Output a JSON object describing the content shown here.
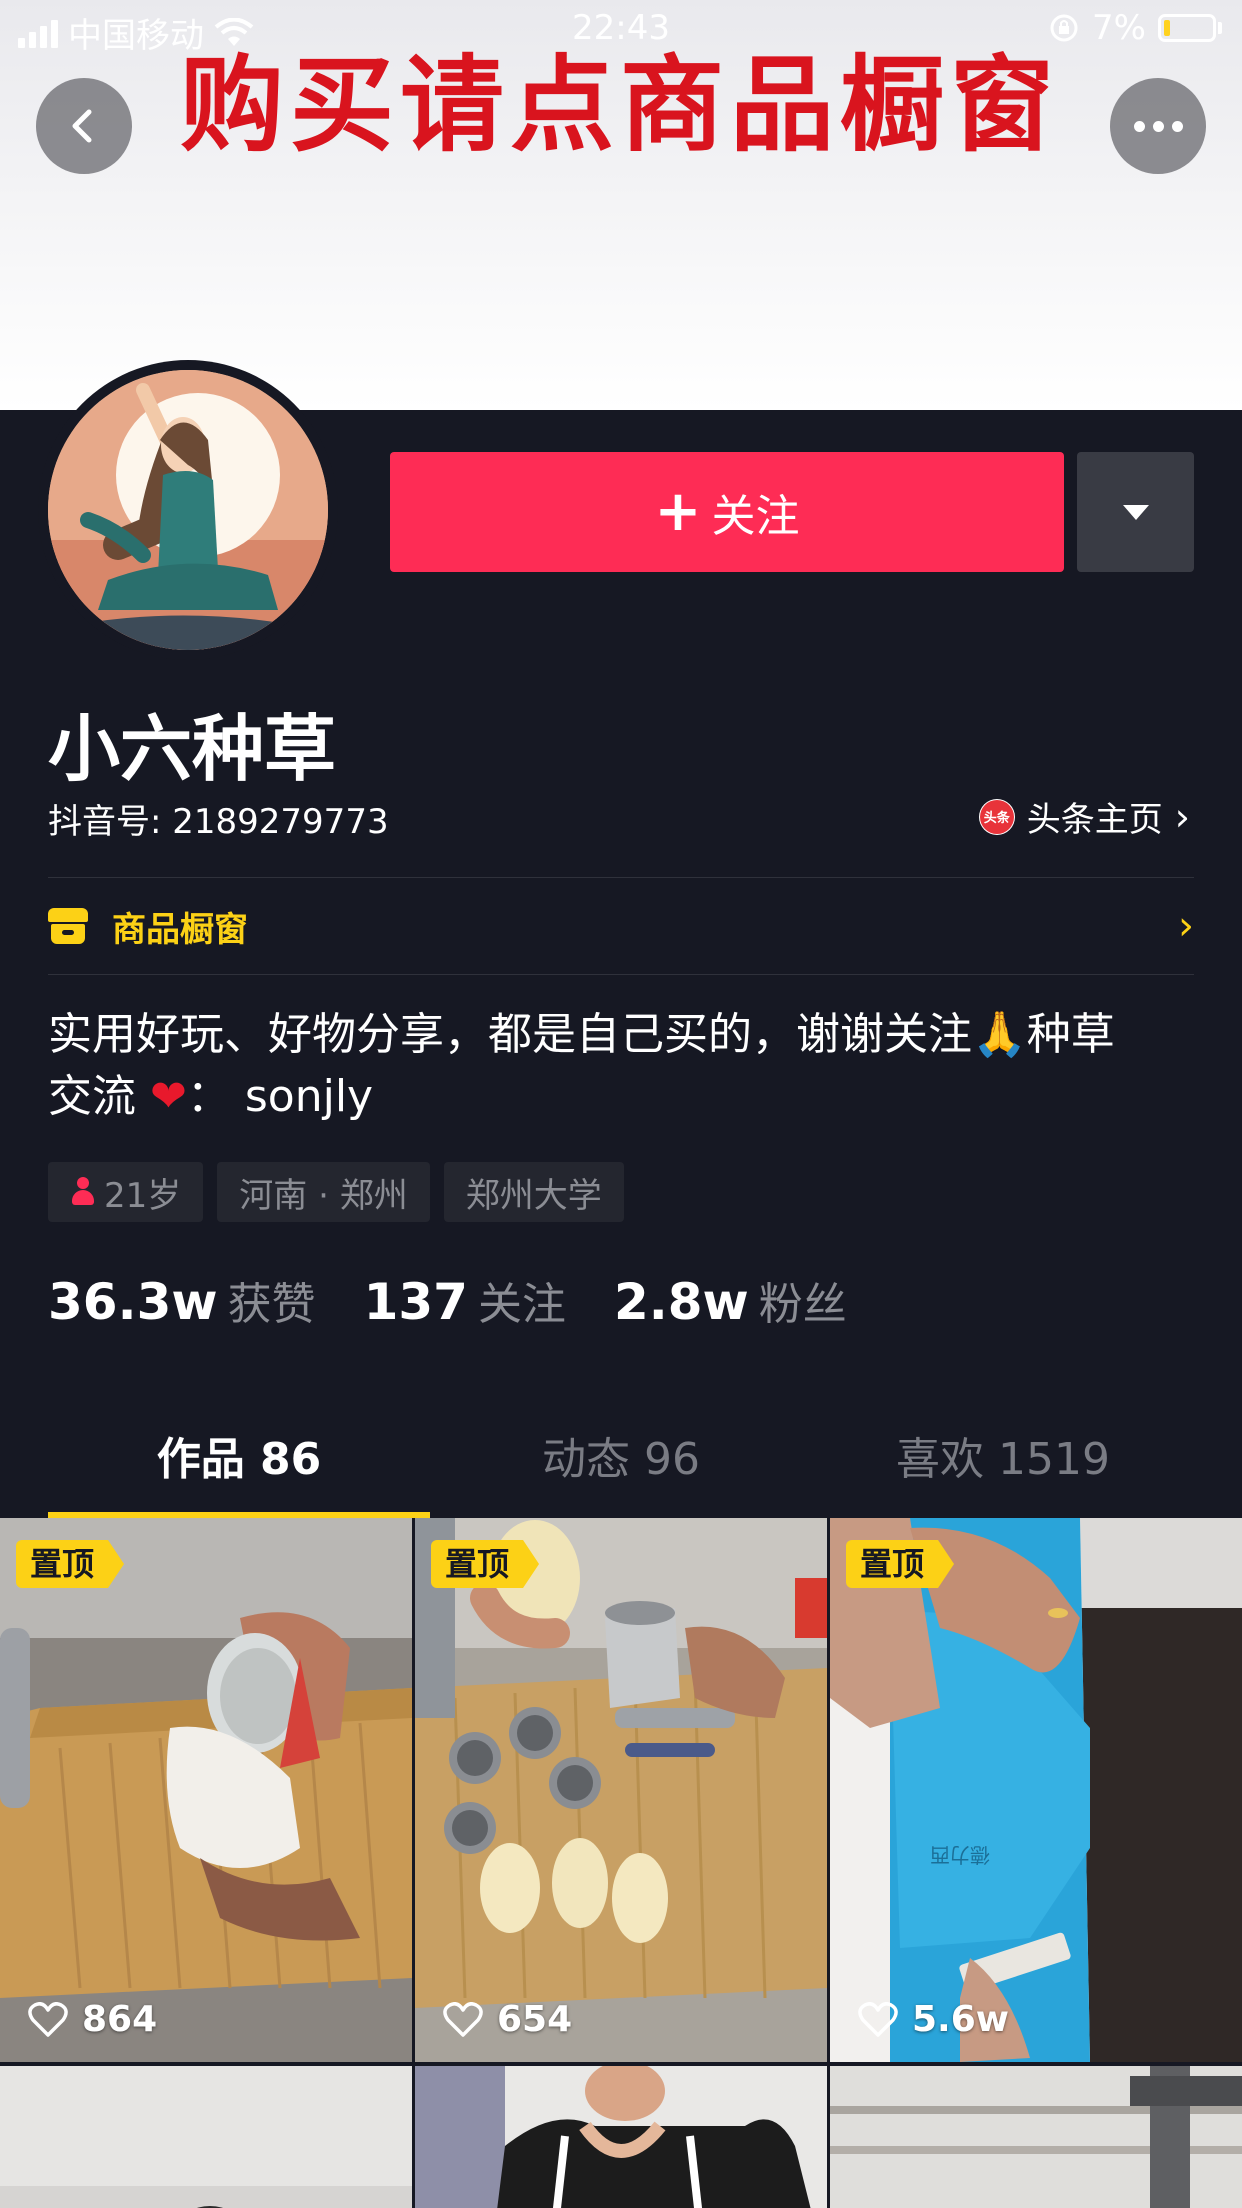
{
  "status_bar": {
    "carrier": "中国移动",
    "time": "22:43",
    "battery": "7%"
  },
  "banner": {
    "text": "购买请点商品橱窗"
  },
  "header": {
    "back_icon": "chevron-left-icon",
    "more_icon": "more-dots-icon"
  },
  "profile": {
    "nickname": "小六种草",
    "douyin_id": "抖音号: 2189279773",
    "toutiao_link": "头条主页",
    "toutiao_icon_text": "头条",
    "follow_label": "关注",
    "shop_window": "商品橱窗",
    "bio_line1_a": "实用好玩、好物分享，都是自己买的，谢谢关注",
    "bio_line1_b": "种草",
    "bio_line2_a": "交流",
    "bio_line2_b": "：  sonjly",
    "tags": {
      "age": "21岁",
      "location": "河南 · 郑州",
      "school": "郑州大学"
    },
    "stats": {
      "likes_num": "36.3w",
      "likes_label": "获赞",
      "following_num": "137",
      "following_label": "关注",
      "fans_num": "2.8w",
      "fans_label": "粉丝"
    }
  },
  "tabs": {
    "works": "作品 86",
    "moments": "动态 96",
    "liked": "喜欢 1519"
  },
  "grid": {
    "pin_label": "置顶",
    "items": [
      {
        "likes": "864"
      },
      {
        "likes": "654"
      },
      {
        "likes": "5.6w"
      }
    ]
  },
  "colors": {
    "background": "#161823",
    "follow_button": "#fe2c55",
    "accent_yellow": "#fcd116",
    "banner_text": "#d9141e"
  }
}
